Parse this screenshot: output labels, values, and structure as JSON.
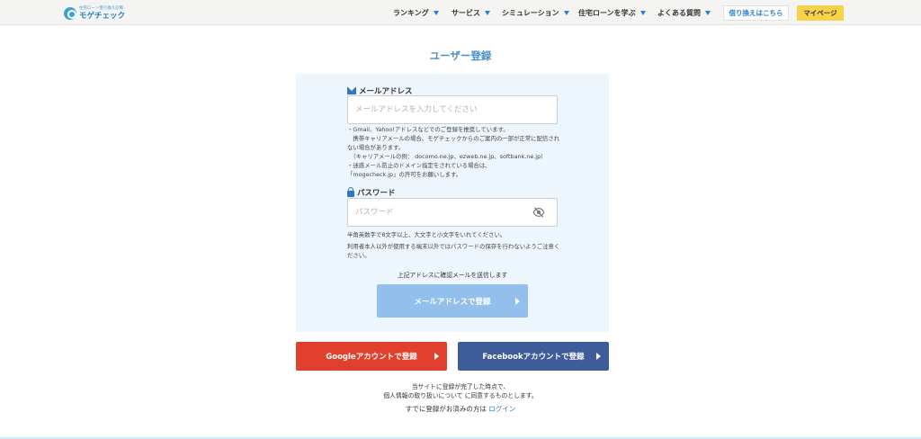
{
  "header": {
    "logo_tagline": "住宅ローン借り換え診断",
    "logo_name": "モゲチェック",
    "nav": [
      {
        "label": "ランキング"
      },
      {
        "label": "サービス"
      },
      {
        "label": "シミュレーション"
      },
      {
        "label": "住宅ローンを学ぶ"
      },
      {
        "label": "よくある質問"
      }
    ],
    "refinance_button": "借り換えはこちら",
    "mypage_button": "マイページ"
  },
  "page_title": "ユーザー登録",
  "form": {
    "email_label": "メールアドレス",
    "email_placeholder": "メールアドレスを入力してください",
    "email_value": "",
    "email_note": "・Gmail、Yahoo!アドレスなどでのご登録を推奨しています。\n　携帯キャリアメールの場合、モゲチェックからのご案内の一部が正常に配信されない場合があります。\n　（キャリアメールの例： docomo.ne.jp、ezweb.ne.jp、softbank.ne.jp）\n・迷惑メール防止のドメイン指定をされている場合は、\n「mogecheck.jp」の許可をお願いします。",
    "password_label": "パスワード",
    "password_placeholder": "パスワード",
    "password_value": "",
    "password_note_1": "半角英数字で8文字以上、大文字と小文字をいれてください。",
    "password_note_2": "利用者本人以外が使用する端末以外ではパスワードの保存を行わないようご注意ください。",
    "confirm_text": "上記アドレスに確認メールを送信します",
    "submit_button": "メールアドレスで登録"
  },
  "social": {
    "google_button": "Googleアカウントで登録",
    "facebook_button": "Facebookアカウントで登録"
  },
  "footer": {
    "agree_line_1": "当サイトに登録が完了した時点で、",
    "agree_line_2": "個人情報の取り扱いについて に同意するものとします。",
    "already_text": "すでに登録がお済みの方は",
    "login_link": "ログイン"
  },
  "colors": {
    "accent": "#2a7fc7",
    "panel_bg": "#eef6fd",
    "submit_disabled": "#92bfeb",
    "google": "#e1402f",
    "facebook": "#3f5c9a",
    "mypage": "#f7d24b"
  }
}
